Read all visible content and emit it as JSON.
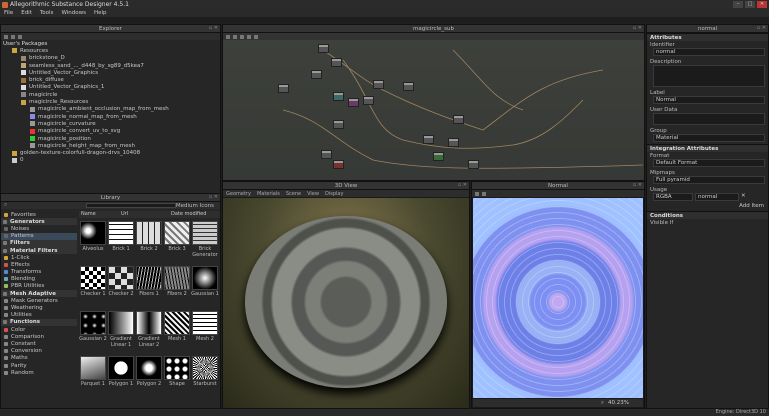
{
  "app": {
    "title": "Allegorithmic Substance Designer 4.5.1"
  },
  "menu": [
    "File",
    "Edit",
    "Tools",
    "Windows",
    "Help"
  ],
  "explorer": {
    "title": "Explorer",
    "root": "User's Packages",
    "items": [
      {
        "label": "Resources",
        "indent": 1,
        "icon": "#c9a640"
      },
      {
        "label": "brickstone_D",
        "indent": 2,
        "icon": "#9a8a70"
      },
      {
        "label": "seamless_sand_..._d448_by_sg89_d5kea7",
        "indent": 2,
        "icon": "#bca67a"
      },
      {
        "label": "Untitled_Vector_Graphics",
        "indent": 2,
        "icon": "#ddd"
      },
      {
        "label": "brick_diffuse",
        "indent": 2,
        "icon": "#a0703a"
      },
      {
        "label": "Untitled_Vector_Graphics_1",
        "indent": 2,
        "icon": "#ddd"
      },
      {
        "label": "magicircle",
        "indent": 2,
        "icon": "#888"
      },
      {
        "label": "magicircle_Resources",
        "indent": 2,
        "icon": "#c9a640"
      },
      {
        "label": "magicircle_ambient_occlusion_map_from_mesh",
        "indent": 3,
        "icon": "#999"
      },
      {
        "label": "magicircle_normal_map_from_mesh",
        "indent": 3,
        "icon": "#8a8aee"
      },
      {
        "label": "magicircle_curvature",
        "indent": 3,
        "icon": "#999"
      },
      {
        "label": "magicircle_convert_uv_to_svg",
        "indent": 3,
        "icon": "#e33"
      },
      {
        "label": "magicircle_position",
        "indent": 3,
        "icon": "#3c3"
      },
      {
        "label": "magicircle_height_map_from_mesh",
        "indent": 3,
        "icon": "#999"
      },
      {
        "label": "golden-texture-colorfull-dragon-drvs_10408",
        "indent": 1,
        "icon": "#c9a640"
      },
      {
        "label": "0",
        "indent": 1,
        "icon": "#ccc"
      }
    ]
  },
  "graph": {
    "title": "magicircle_sub"
  },
  "library": {
    "title": "Library",
    "search_placeholder": "",
    "icon_size": "Medium Icons",
    "columns": [
      "Name",
      "Url",
      "Date modified"
    ],
    "categories": [
      {
        "label": "Favorites",
        "hdr": false,
        "icon": "#d4a63a"
      },
      {
        "label": "Generators",
        "hdr": true,
        "icon": "#7a7a7a"
      },
      {
        "label": "Noises",
        "hdr": false,
        "icon": "#666"
      },
      {
        "label": "Patterns",
        "hdr": false,
        "icon": "#666",
        "sel": true
      },
      {
        "label": "Filters",
        "hdr": true,
        "icon": "#7a7a7a"
      },
      {
        "label": "Material Filters",
        "hdr": true,
        "icon": "#7a7a7a"
      },
      {
        "label": "1-Click",
        "hdr": false,
        "icon": "#d4a63a"
      },
      {
        "label": "Effects",
        "hdr": false,
        "icon": "#c55"
      },
      {
        "label": "Transforms",
        "hdr": false,
        "icon": "#5a8acf"
      },
      {
        "label": "Blending",
        "hdr": false,
        "icon": "#6ab"
      },
      {
        "label": "PBR Utilities",
        "hdr": false,
        "icon": "#9b6"
      },
      {
        "label": "Mesh Adaptive",
        "hdr": true,
        "icon": "#7a7a7a"
      },
      {
        "label": "Mask Generators",
        "hdr": false,
        "icon": "#888"
      },
      {
        "label": "Weathering",
        "hdr": false,
        "icon": "#888"
      },
      {
        "label": "Utilities",
        "hdr": false,
        "icon": "#888"
      },
      {
        "label": "Functions",
        "hdr": true,
        "icon": "#7a7a7a"
      },
      {
        "label": "Color",
        "hdr": false,
        "icon": "#c55"
      },
      {
        "label": "Comparison",
        "hdr": false,
        "icon": "#888"
      },
      {
        "label": "Constant",
        "hdr": false,
        "icon": "#888"
      },
      {
        "label": "Conversion",
        "hdr": false,
        "icon": "#888"
      },
      {
        "label": "Maths",
        "hdr": false,
        "icon": "#888"
      },
      {
        "label": "Parity",
        "hdr": false,
        "icon": "#888"
      },
      {
        "label": "Random",
        "hdr": false,
        "icon": "#888"
      }
    ],
    "thumbs": [
      {
        "label": "Alveolus",
        "style": "radial-gradient(circle at 30% 40%,#fff 10%,#000 40%)"
      },
      {
        "label": "Brick 1",
        "style": "repeating-linear-gradient(0deg,#fff 0 4px,#111 4px 5px)"
      },
      {
        "label": "Brick 2",
        "style": "repeating-linear-gradient(90deg,#ddd 0 5px,#222 5px 6px)"
      },
      {
        "label": "Brick 3",
        "style": "repeating-linear-gradient(45deg,#eee 0 3px,#777 3px 5px)"
      },
      {
        "label": "Brick Generator",
        "style": "repeating-linear-gradient(0deg,#ccc 0 3px,#333 3px 4px)"
      },
      {
        "label": "Checker 1",
        "style": "repeating-conic-gradient(#000 0 25%,#fff 0 50%) 0 0/8px 8px"
      },
      {
        "label": "Checker 2",
        "style": "repeating-conic-gradient(#222 0 25%,#ddd 0 50%) 0 0/12px 12px"
      },
      {
        "label": "Fibers 1",
        "style": "repeating-linear-gradient(100deg,#000 0 2px,#bbb 2px 3px)"
      },
      {
        "label": "Fibers 2",
        "style": "repeating-linear-gradient(80deg,#111 0 1px,#888 1px 3px)"
      },
      {
        "label": "Gaussian 1",
        "style": "radial-gradient(circle,#fff 0,#000 70%)"
      },
      {
        "label": "Gaussian 2",
        "style": "radial-gradient(circle,#fff 0,#000 40%) 0 0/9px 9px"
      },
      {
        "label": "Gradient Linear 1",
        "style": "linear-gradient(90deg,#000,#fff)"
      },
      {
        "label": "Gradient Linear 2",
        "style": "linear-gradient(90deg,#fff,#000,#fff)"
      },
      {
        "label": "Mesh 1",
        "style": "repeating-linear-gradient(45deg,#000 0 2px,#eee 2px 4px)"
      },
      {
        "label": "Mesh 2",
        "style": "repeating-linear-gradient(0deg,#fff 0 3px,#000 3px 4px)"
      },
      {
        "label": "Parquet 1",
        "style": "linear-gradient(160deg,#eee,#444)"
      },
      {
        "label": "Polygon 1",
        "style": "radial-gradient(circle,#fff 0 40%,#000 42%)"
      },
      {
        "label": "Polygon 2",
        "style": "radial-gradient(circle,#fff 0 20%,#000 50%)"
      },
      {
        "label": "Shape",
        "style": "radial-gradient(circle,#fff 0 2px,#000 3px) 0 0/8px 8px"
      },
      {
        "label": "Starburst",
        "style": "repeating-conic-gradient(#000 0 5deg,#fff 5deg 10deg)"
      }
    ]
  },
  "view3d": {
    "title": "3D View",
    "menus": [
      "Geometry",
      "Materials",
      "Scene",
      "View",
      "Display"
    ]
  },
  "view2d": {
    "title": "Normal",
    "zoom": "40.23%"
  },
  "attributes": {
    "title": "normal",
    "header": "Attributes",
    "identifier_label": "Identifier",
    "identifier": "normal",
    "description_label": "Description",
    "label_label": "Label",
    "label": "Normal",
    "userdata_label": "User Data",
    "group_label": "Group",
    "group": "Material",
    "integration_header": "Integration Attributes",
    "format_label": "Format",
    "format": "Default Format",
    "mipmaps_label": "Mipmaps",
    "mipmaps": "Full pyramid",
    "usage_label": "Usage",
    "usage_channel": "RGBA",
    "usage_value": "normal",
    "add_item": "Add Item",
    "conditions_header": "Conditions",
    "visible_if": "Visible If"
  },
  "status": {
    "engine": "Engine: Direct3D 10"
  },
  "colors": {
    "accent": "#3a4a5a",
    "wire": "#a08560"
  }
}
